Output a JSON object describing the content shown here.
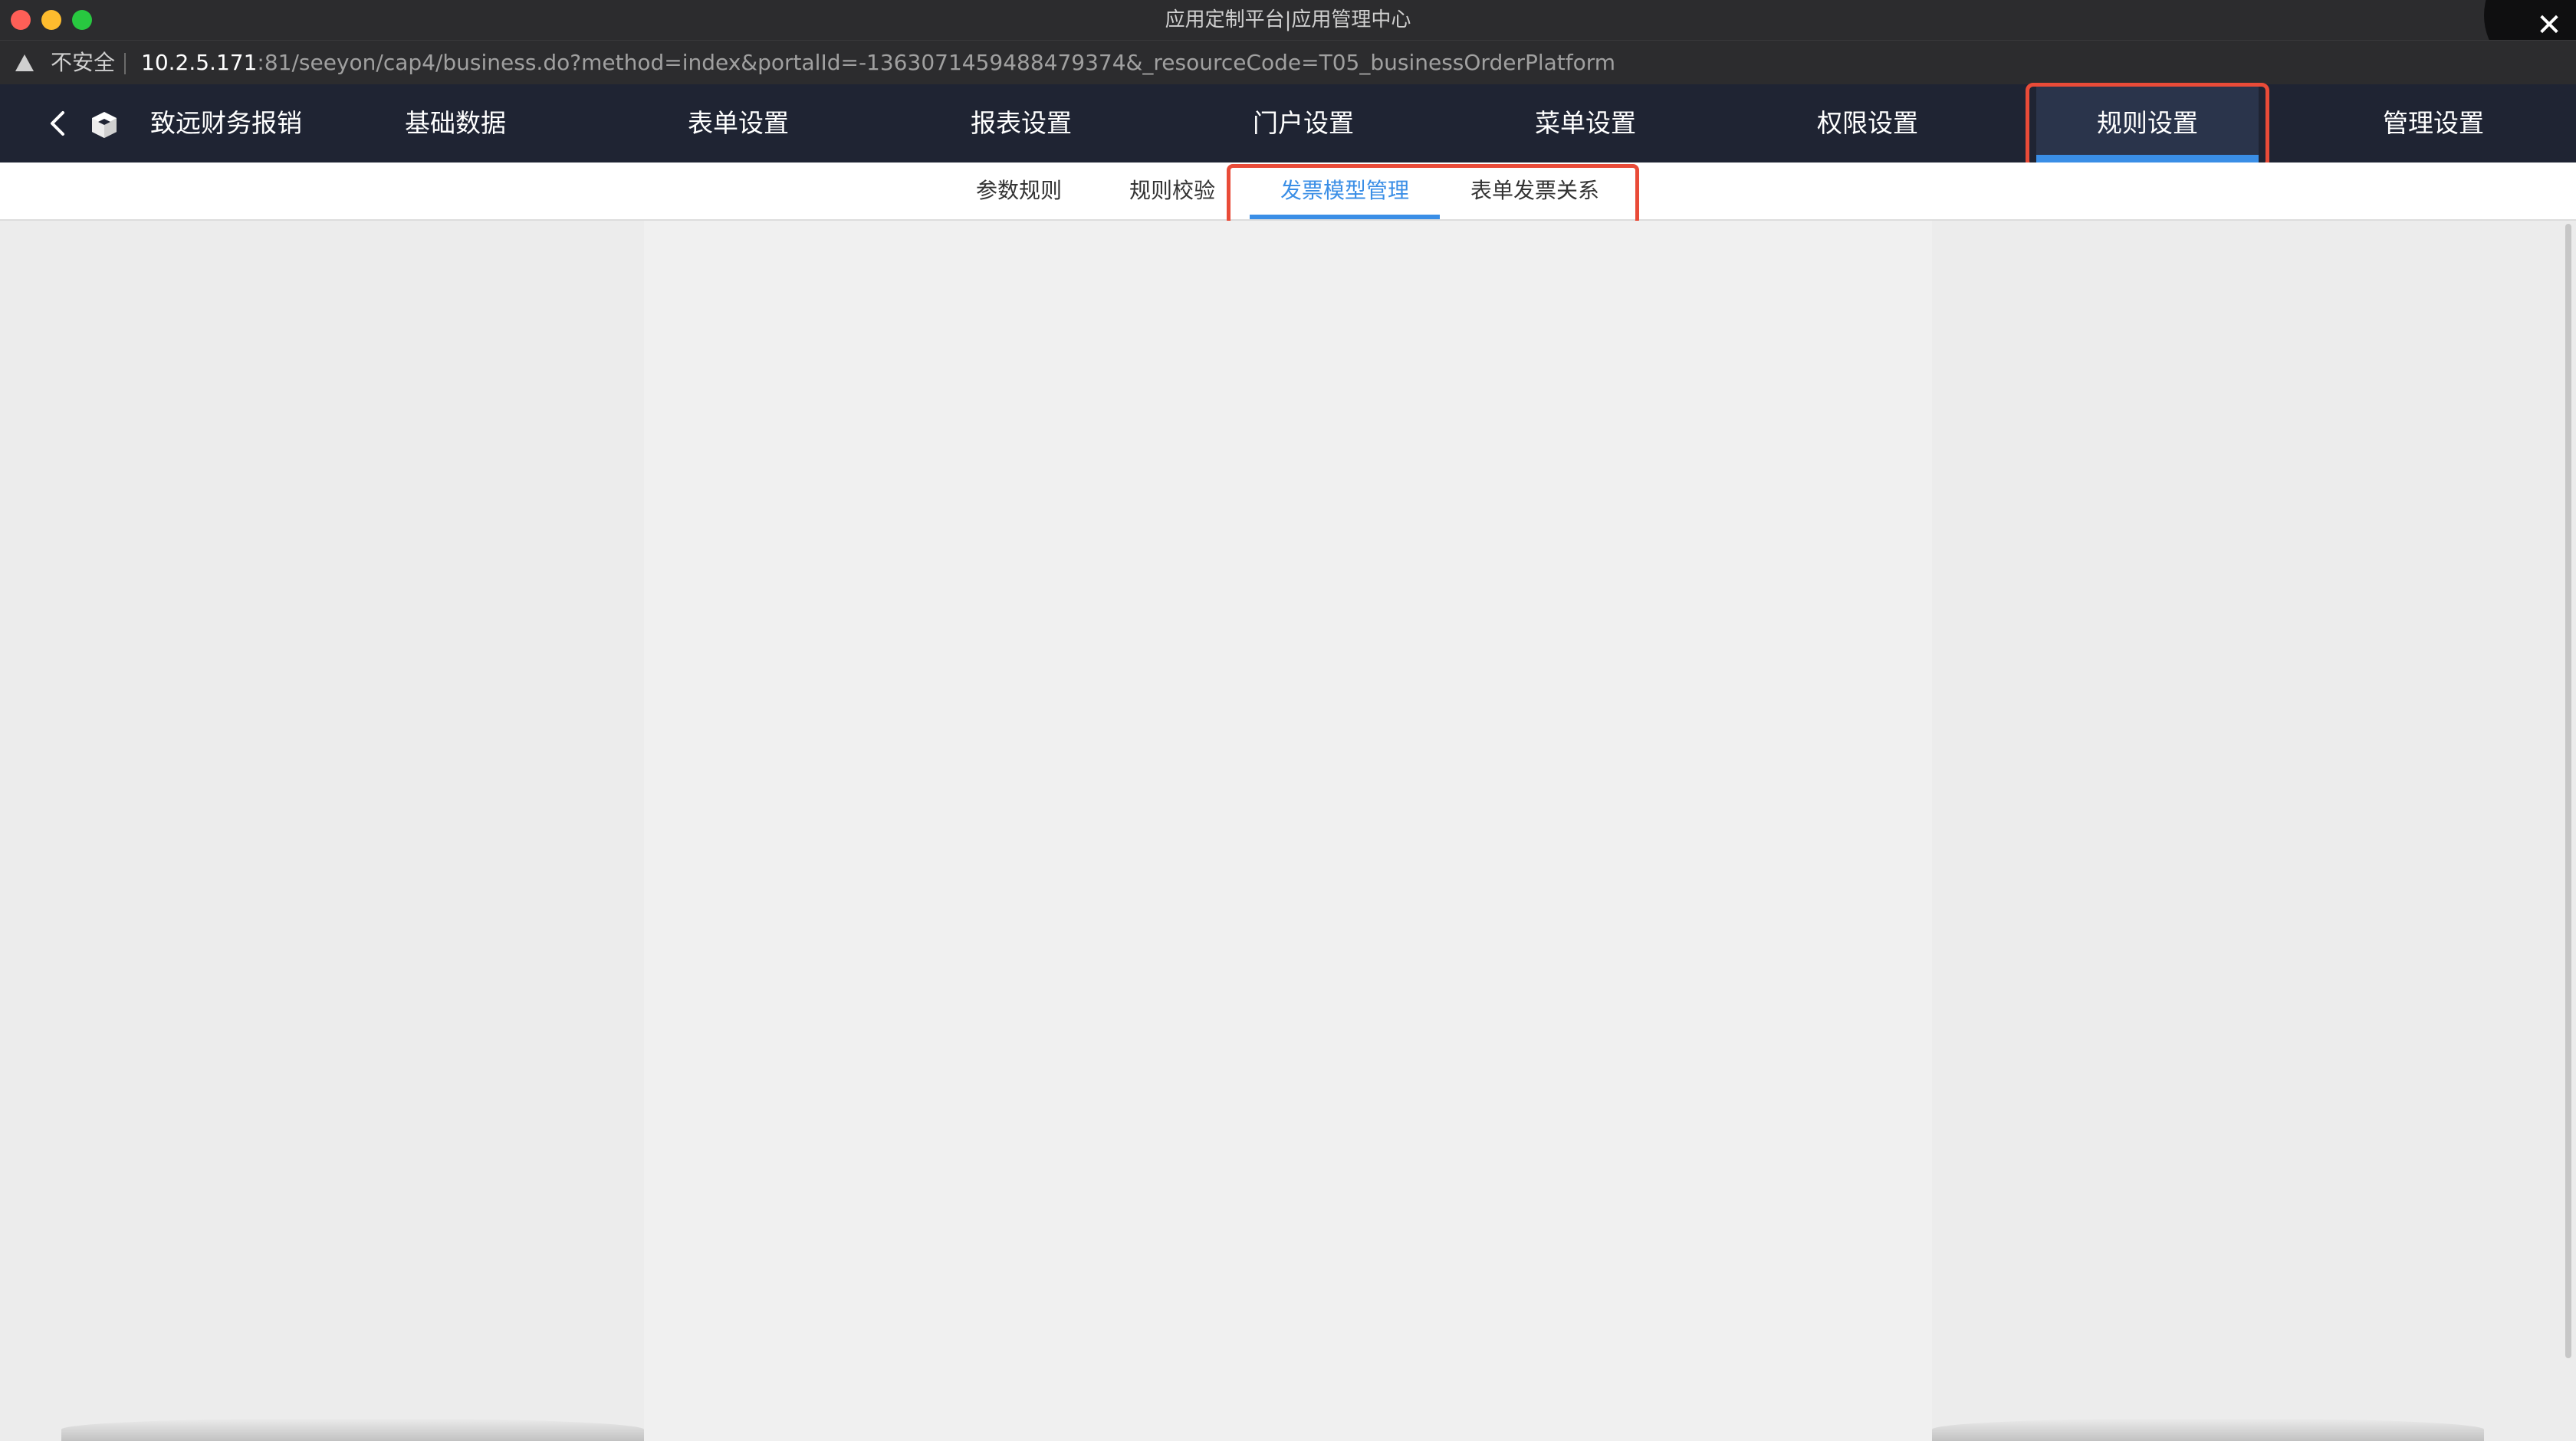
{
  "window": {
    "title": "应用定制平台|应用管理中心"
  },
  "addressbar": {
    "security_label": "不安全",
    "url_host": "10.2.5.171",
    "url_rest": ":81/seeyon/cap4/business.do?method=index&portalId=-1363071459488479374&_resourceCode=T05_businessOrderPlatform"
  },
  "appnav": {
    "app_name": "致远财务报销",
    "items": [
      {
        "label": "基础数据"
      },
      {
        "label": "表单设置"
      },
      {
        "label": "报表设置"
      },
      {
        "label": "门户设置"
      },
      {
        "label": "菜单设置"
      },
      {
        "label": "权限设置"
      },
      {
        "label": "规则设置",
        "active": true
      },
      {
        "label": "管理设置"
      }
    ]
  },
  "subtabs": {
    "items": [
      {
        "label": "参数规则"
      },
      {
        "label": "规则校验"
      },
      {
        "label": "发票模型管理",
        "active": true
      },
      {
        "label": "表单发票关系"
      }
    ]
  },
  "colors": {
    "accent": "#3a8ee6",
    "highlight": "#e94b38",
    "nav_bg": "#1f2433"
  }
}
